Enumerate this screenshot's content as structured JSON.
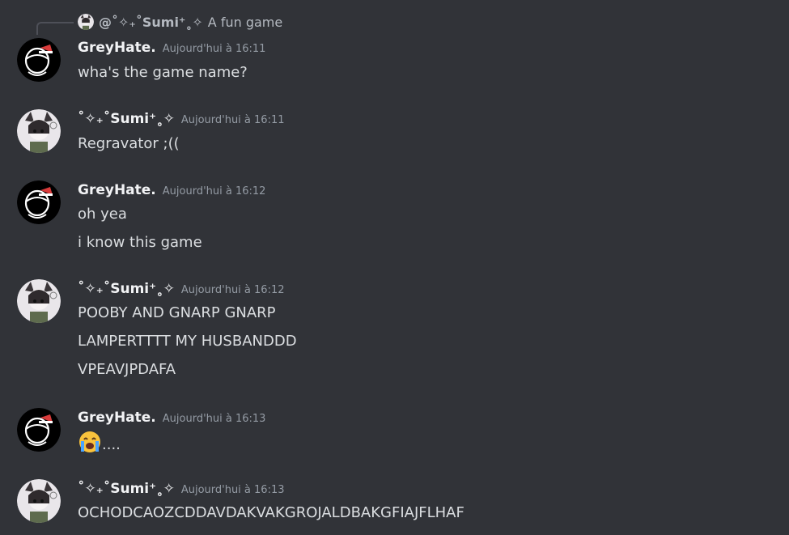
{
  "reply": {
    "author": "@˚✧₊˚Sumi⁺˳✧",
    "text": "A fun game"
  },
  "messages": [
    {
      "author": "GreyHate.",
      "timestamp": "Aujourd'hui à 16:11",
      "avatar": "greyhate-avatar",
      "lines": [
        "wha's the game name?"
      ]
    },
    {
      "author": "˚✧₊˚Sumi⁺˳✧",
      "timestamp": "Aujourd'hui à 16:11",
      "avatar": "sumi-avatar",
      "lines": [
        "Regravator ;(("
      ]
    },
    {
      "author": "GreyHate.",
      "timestamp": "Aujourd'hui à 16:12",
      "avatar": "greyhate-avatar",
      "lines": [
        "oh yea",
        "i know this game"
      ]
    },
    {
      "author": "˚✧₊˚Sumi⁺˳✧",
      "timestamp": "Aujourd'hui à 16:12",
      "avatar": "sumi-avatar",
      "lines": [
        "POOBY AND GNARP GNARP",
        "LAMPERTTTT MY HUSBANDDD",
        "VPEAVJPDAFA"
      ]
    },
    {
      "author": "GreyHate.",
      "timestamp": "Aujourd'hui à 16:13",
      "avatar": "greyhate-avatar",
      "emoji": "loudly-crying-face-emoji",
      "lines": [
        "...."
      ]
    },
    {
      "author": "˚✧₊˚Sumi⁺˳✧",
      "timestamp": "Aujourd'hui à 16:13",
      "avatar": "sumi-avatar",
      "lines": [
        "OCHODCAOZCDDAVDAKVAKGROJALDBAKGFIAJFLHAF"
      ]
    }
  ],
  "colors": {
    "background": "#313338",
    "username": "#f2f3f5",
    "text": "#dbdee1",
    "timestamp": "#949ba4",
    "reply_line": "#4e5058"
  }
}
